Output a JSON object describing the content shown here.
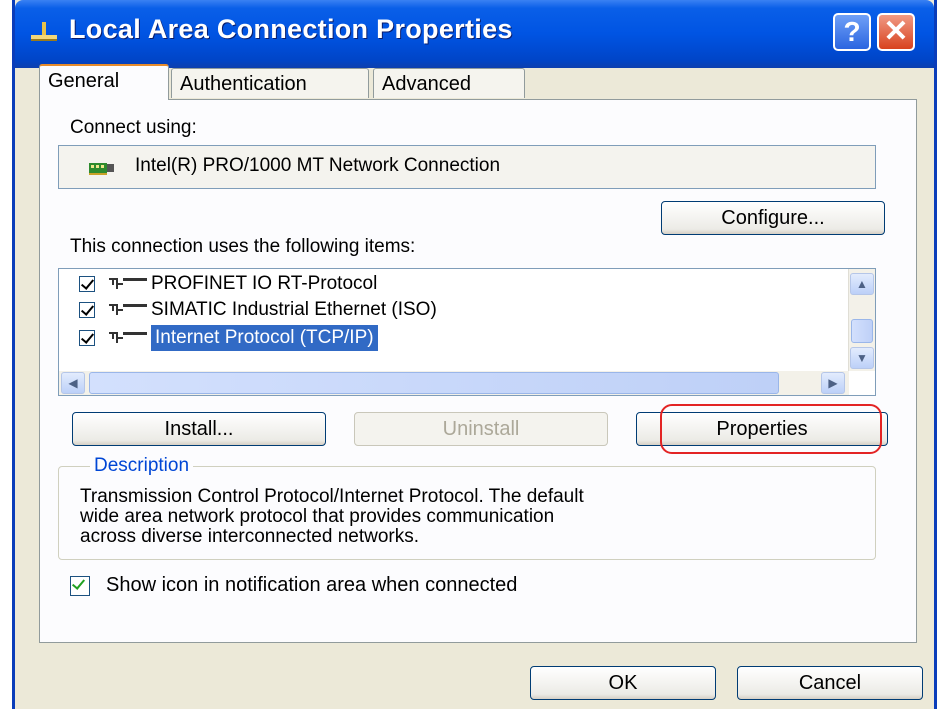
{
  "window": {
    "title": "Local Area Connection Properties",
    "help_label": "?",
    "close_label": "✕"
  },
  "tabs": [
    {
      "label": "General",
      "active": true
    },
    {
      "label": "Authentication",
      "active": false
    },
    {
      "label": "Advanced",
      "active": false
    }
  ],
  "connect_using": {
    "label": "Connect using:",
    "adapter": "Intel(R) PRO/1000 MT Network Connection",
    "adapter_icon": "network-card-icon",
    "configure_label": "Configure..."
  },
  "items": {
    "label": "This connection uses the following items:",
    "list": [
      {
        "label": "PROFINET IO RT-Protocol",
        "checked": true,
        "selected": false,
        "icon": "network-protocol-icon"
      },
      {
        "label": "SIMATIC Industrial Ethernet (ISO)",
        "checked": true,
        "selected": false,
        "icon": "network-protocol-icon"
      },
      {
        "label": "Internet Protocol (TCP/IP)",
        "checked": true,
        "selected": true,
        "icon": "network-protocol-icon"
      }
    ]
  },
  "buttons": {
    "install": "Install...",
    "uninstall": "Uninstall",
    "properties": "Properties",
    "ok": "OK",
    "cancel": "Cancel"
  },
  "description": {
    "legend": "Description",
    "lines": [
      "Transmission Control Protocol/Internet Protocol. The default",
      "wide area network protocol that provides communication",
      "across diverse interconnected networks."
    ]
  },
  "notify": {
    "label": "Show icon in notification area when connected",
    "checked": true
  },
  "colors": {
    "title_bar": "#0054E3",
    "selection": "#316AC5",
    "highlight_ring": "#E32424",
    "legend_text": "#0046D5"
  }
}
